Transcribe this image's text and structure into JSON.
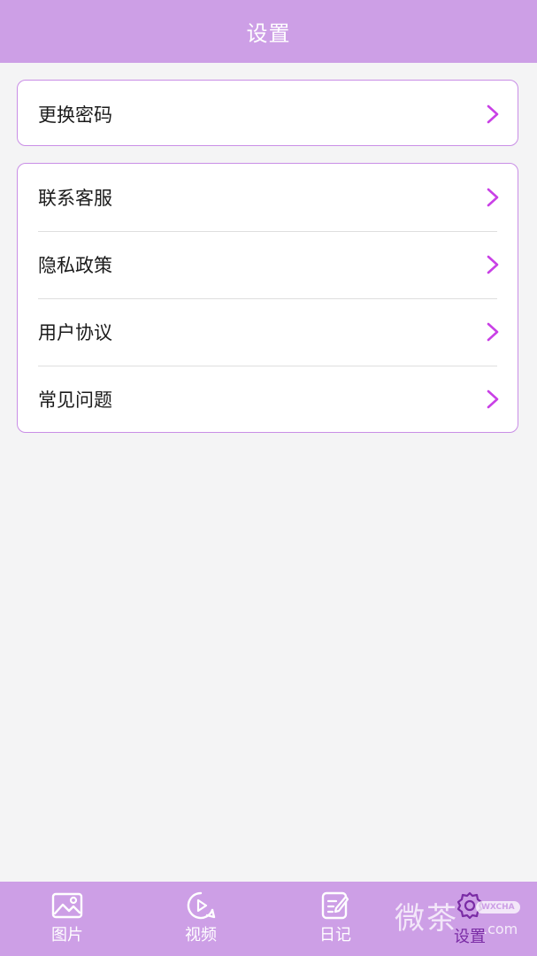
{
  "header": {
    "title": "设置"
  },
  "groups": [
    {
      "items": [
        {
          "label": "更换密码"
        }
      ]
    },
    {
      "items": [
        {
          "label": "联系客服"
        },
        {
          "label": "隐私政策"
        },
        {
          "label": "用户协议"
        },
        {
          "label": "常见问题"
        }
      ]
    }
  ],
  "tabbar": {
    "tabs": [
      {
        "label": "图片",
        "icon": "image-icon"
      },
      {
        "label": "视频",
        "icon": "play-icon"
      },
      {
        "label": "日记",
        "icon": "note-icon"
      },
      {
        "label": "设置",
        "icon": "gear-icon",
        "active": true
      }
    ]
  },
  "watermark": {
    "text": "微茶",
    "badge": "WXCHA",
    "domain": ".com"
  },
  "colors": {
    "primary": "#cd9fe6",
    "border": "#c98ee6",
    "chevron": "#c940e6",
    "active_tab": "#7a2ca5",
    "background": "#f4f4f5"
  }
}
